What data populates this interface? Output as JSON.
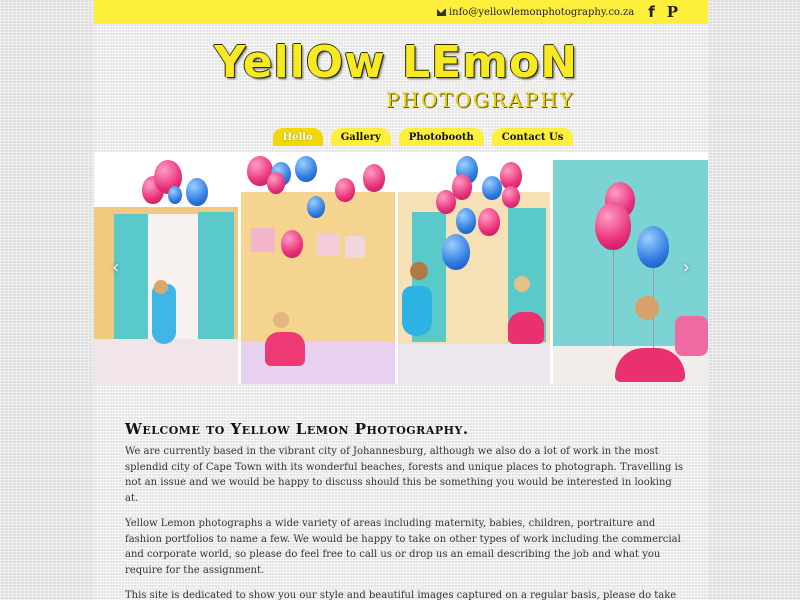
{
  "topbar": {
    "email": "info@yellowlemonphotography.co.za",
    "facebook_icon": "f",
    "pinterest_icon": "P"
  },
  "logo": {
    "line1": "YellOw LEmoN",
    "line2": "PHOTOGRAPHY"
  },
  "nav": {
    "items": [
      {
        "label": "Hello",
        "active": true
      },
      {
        "label": "Gallery",
        "active": false
      },
      {
        "label": "Photobooth",
        "active": false
      },
      {
        "label": "Contact Us",
        "active": false
      }
    ]
  },
  "slider": {
    "prev": "‹",
    "next": "›"
  },
  "welcome": {
    "heading": "Welcome to Yellow Lemon Photography.",
    "p1": "We are currently based in the vibrant city of Johannesburg, although we also do a lot of work in the most splendid city of Cape Town with its wonderful beaches, forests and unique places to photograph. Travelling is not an issue and we would be happy to discuss should this be something you would be interested in looking at.",
    "p2": "Yellow Lemon photographs a wide variety of areas including maternity, babies, children, portraiture and fashion portfolios to name a few. We would be happy to take on other types of work including the commercial and corporate world, so please do feel free to call us or drop us an email describing the job and what you require for the assignment.",
    "p3": "This site is dedicated to show you our style and beautiful images captured on a regular basis, please do take your time to enjoy all the images and make sure to drop us an email with any queries or comments."
  },
  "colors": {
    "accent": "#fdef3b",
    "tab_active": "#f2d800"
  }
}
